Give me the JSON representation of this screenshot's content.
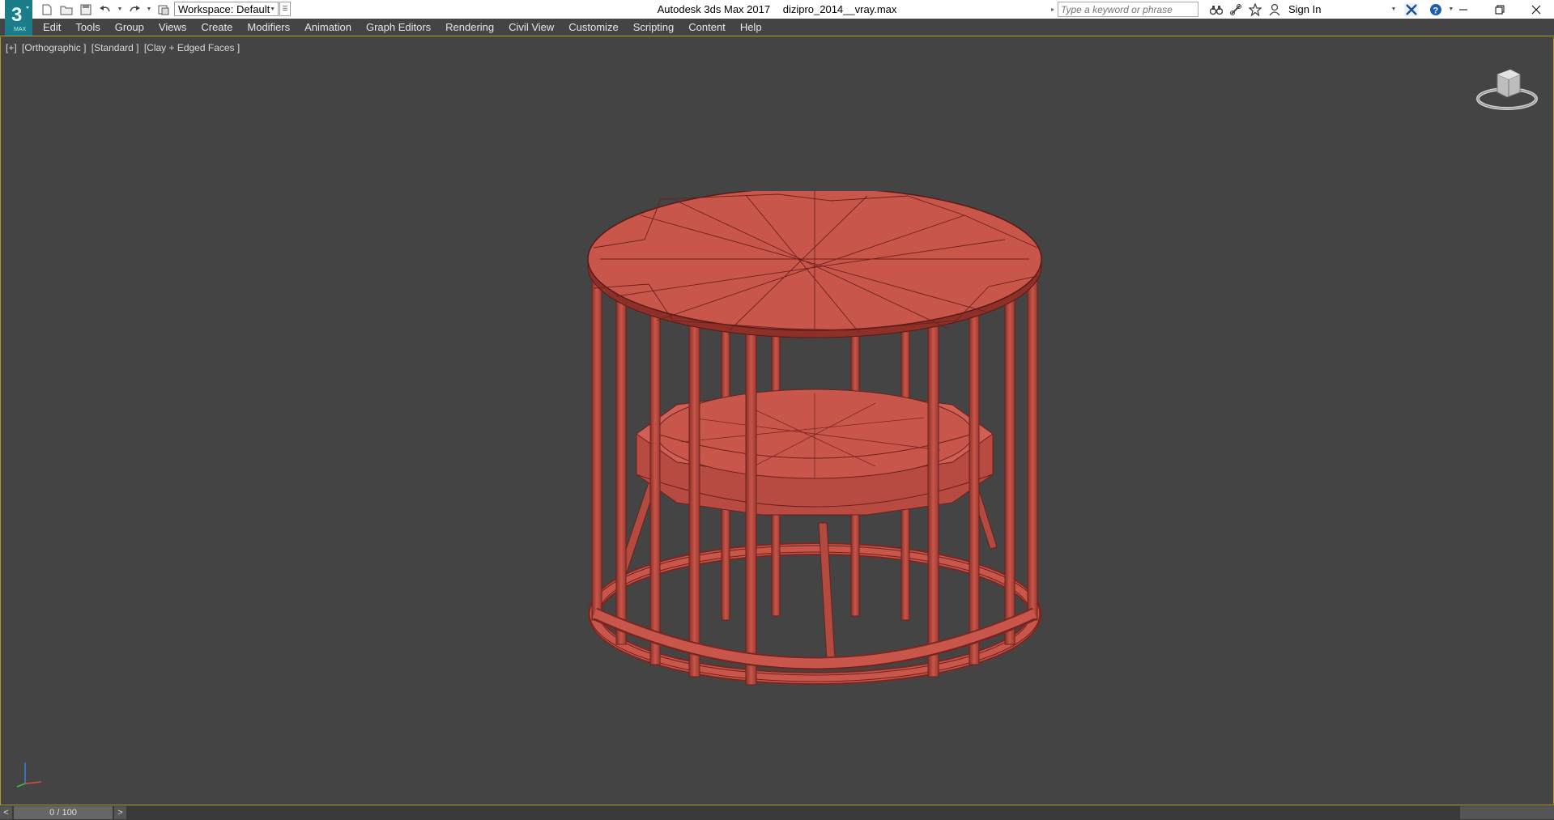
{
  "window": {
    "app_name": "Autodesk 3ds Max 2017",
    "file_name": "dizipro_2014__vray.max"
  },
  "toolbar": {
    "workspace_label": "Workspace: Default",
    "search_placeholder": "Type a keyword or phrase",
    "sign_in_label": "Sign In"
  },
  "menu": {
    "items": [
      "Edit",
      "Tools",
      "Group",
      "Views",
      "Create",
      "Modifiers",
      "Animation",
      "Graph Editors",
      "Rendering",
      "Civil View",
      "Customize",
      "Scripting",
      "Content",
      "Help"
    ]
  },
  "viewport": {
    "labels": [
      "[+]",
      "[Orthographic ]",
      "[Standard ]",
      "[Clay + Edged Faces ]"
    ]
  },
  "timeline": {
    "frame_display": "0 / 100",
    "prev_label": "<",
    "next_label": ">"
  },
  "colors": {
    "model": "#c8564a",
    "model_dark": "#8e2f28",
    "viewport_bg": "#444444",
    "accent_border": "#b59a2a"
  }
}
